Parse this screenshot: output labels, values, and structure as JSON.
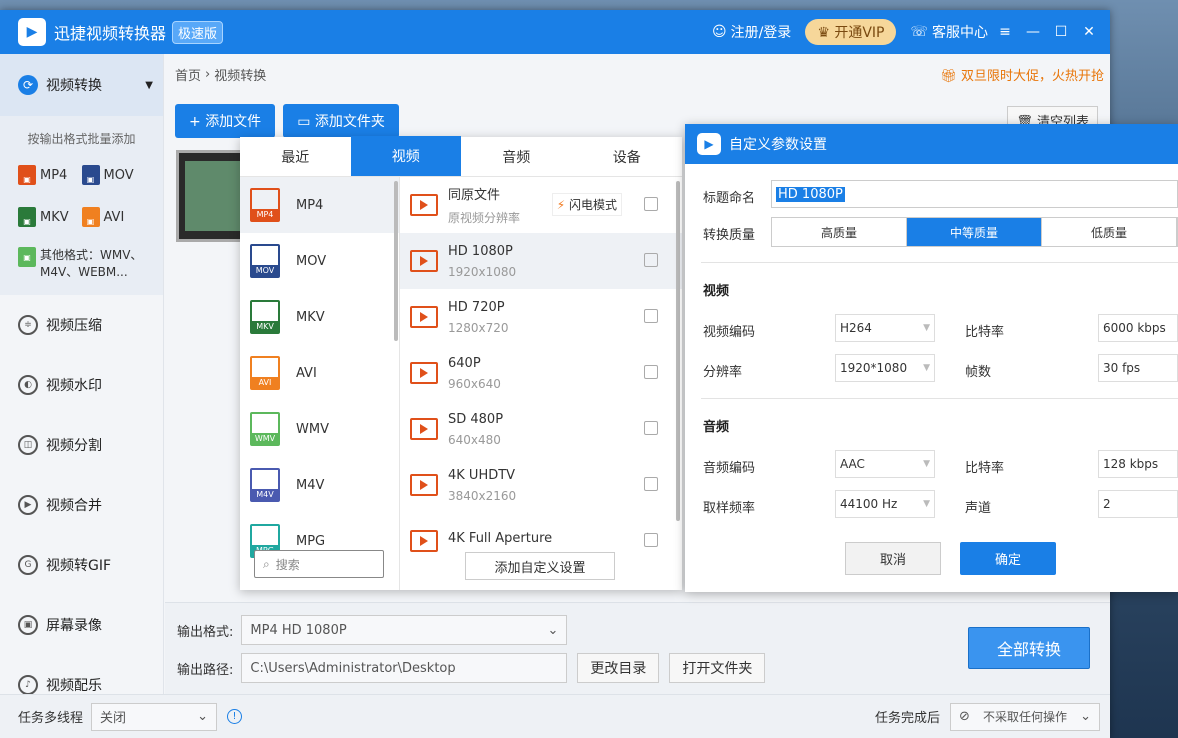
{
  "titlebar": {
    "app_name": "迅捷视频转换器",
    "edition": "极速版",
    "login": "注册/登录",
    "vip": "开通VIP",
    "service": "客服中心"
  },
  "sidebar": {
    "main": "视频转换",
    "hint": "按输出格式批量添加",
    "formats": [
      {
        "label": "MP4",
        "color": "#e0501a"
      },
      {
        "label": "MOV",
        "color": "#2a4a8e"
      },
      {
        "label": "MKV",
        "color": "#2a7a3a"
      },
      {
        "label": "AVI",
        "color": "#f08020"
      }
    ],
    "other": "其他格式：WMV、M4V、WEBM...",
    "items": [
      "视频压缩",
      "视频水印",
      "视频分割",
      "视频合并",
      "视频转GIF",
      "屏幕录像",
      "视频配乐"
    ]
  },
  "crumb": {
    "home": "首页",
    "current": "视频转换",
    "promo": "双旦限时大促，火热开抢"
  },
  "toolbar": {
    "add_file": "添加文件",
    "add_folder": "添加文件夹",
    "clear": "清空列表"
  },
  "popup": {
    "tabs": [
      "最近",
      "视频",
      "音频",
      "设备"
    ],
    "formats": [
      {
        "label": "MP4",
        "color": "#e0501a"
      },
      {
        "label": "MOV",
        "color": "#2a4a8e"
      },
      {
        "label": "MKV",
        "color": "#2a7a3a"
      },
      {
        "label": "AVI",
        "color": "#f08020"
      },
      {
        "label": "WMV",
        "color": "#5cb85c"
      },
      {
        "label": "M4V",
        "color": "#4a5ab0"
      },
      {
        "label": "MPG",
        "color": "#20a8a0"
      }
    ],
    "search_placeholder": "搜索",
    "presets": [
      {
        "name": "同原文件",
        "res": "原视频分辨率"
      },
      {
        "name": "HD 1080P",
        "res": "1920x1080"
      },
      {
        "name": "HD 720P",
        "res": "1280x720"
      },
      {
        "name": "640P",
        "res": "960x640"
      },
      {
        "name": "SD 480P",
        "res": "640x480"
      },
      {
        "name": "4K UHDTV",
        "res": "3840x2160"
      },
      {
        "name": "4K Full Aperture",
        "res": ""
      }
    ],
    "flash": "闪电模式",
    "add_custom": "添加自定义设置"
  },
  "dialog": {
    "title": "自定义参数设置",
    "name_label": "标题命名",
    "name_value": "HD 1080P",
    "quality_label": "转换质量",
    "quality": [
      "高质量",
      "中等质量",
      "低质量"
    ],
    "video_section": "视频",
    "video_codec_label": "视频编码",
    "video_codec": "H264",
    "bitrate_label": "比特率",
    "video_bitrate": "6000 kbps",
    "resolution_label": "分辨率",
    "resolution": "1920*1080",
    "fps_label": "帧数",
    "fps": "30 fps",
    "audio_section": "音频",
    "audio_codec_label": "音频编码",
    "audio_codec": "AAC",
    "audio_bitrate": "128 kbps",
    "sample_label": "取样频率",
    "sample_rate": "44100 Hz",
    "channel_label": "声道",
    "channel": "2",
    "cancel": "取消",
    "ok": "确定"
  },
  "bottom": {
    "format_label": "输出格式:",
    "format_value": "MP4  HD 1080P",
    "path_label": "输出路径:",
    "path_value": "C:\\Users\\Administrator\\Desktop",
    "change_dir": "更改目录",
    "open_folder": "打开文件夹",
    "convert_all": "全部转换"
  },
  "footer": {
    "threads_label": "任务多线程",
    "threads_value": "关闭",
    "after_label": "任务完成后",
    "after_value": "不采取任何操作"
  }
}
